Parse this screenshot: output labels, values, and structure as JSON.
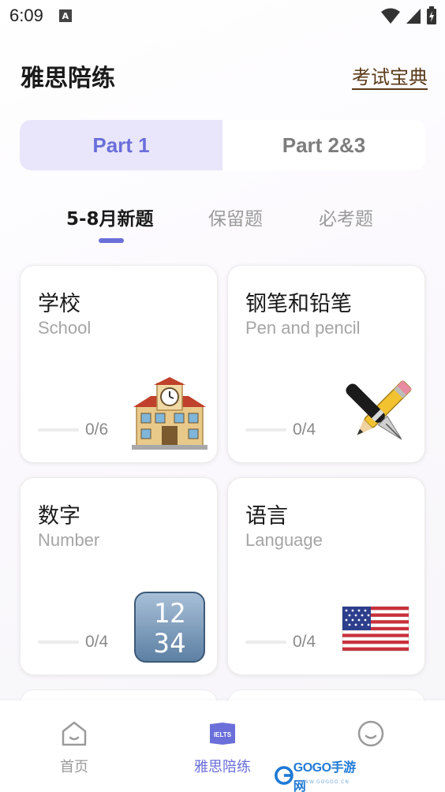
{
  "status": {
    "time": "6:09",
    "a_badge": "A"
  },
  "header": {
    "title": "雅思陪练",
    "link": "考试宝典"
  },
  "part_tabs": [
    {
      "label": "Part 1",
      "active": true
    },
    {
      "label": "Part 2&3",
      "active": false
    }
  ],
  "sub_tabs": [
    {
      "label": "5-8月新题",
      "active": true
    },
    {
      "label": "保留题",
      "active": false
    },
    {
      "label": "必考题",
      "active": false
    }
  ],
  "cards": [
    {
      "title": "学校",
      "subtitle": "School",
      "count": "0/6",
      "progress": 0,
      "icon": "school-building-icon"
    },
    {
      "title": "钢笔和铅笔",
      "subtitle": "Pen and pencil",
      "count": "0/4",
      "progress": 0,
      "icon": "pen-pencil-icon"
    },
    {
      "title": "数字",
      "subtitle": "Number",
      "count": "0/4",
      "progress": 0,
      "icon": "number-keycap-icon",
      "icon_text_top": "12",
      "icon_text_bottom": "34"
    },
    {
      "title": "语言",
      "subtitle": "Language",
      "count": "0/4",
      "progress": 0,
      "icon": "us-flag-icon"
    }
  ],
  "bottom_nav": [
    {
      "label": "首页",
      "icon": "home-icon",
      "active": false
    },
    {
      "label": "雅思陪练",
      "icon": "ielts-book-icon",
      "badge": "IELTS",
      "active": true
    },
    {
      "label": "",
      "icon": "profile-icon",
      "active": false
    }
  ],
  "watermark": {
    "text": "GOGO手游网",
    "url": "WWW.GOGOO.CN"
  },
  "colors": {
    "accent": "#6a6fd9",
    "active_tab_bg": "#e9e6fb",
    "link": "#5a3a18"
  }
}
